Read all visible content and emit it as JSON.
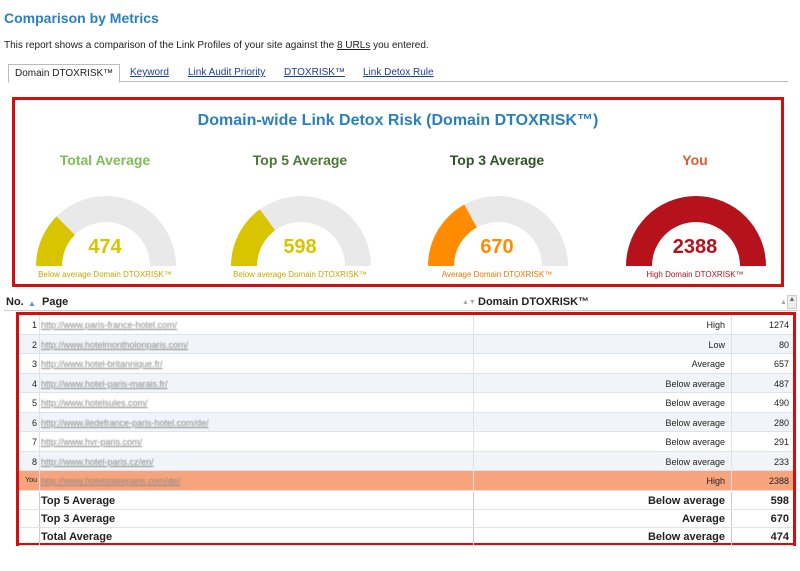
{
  "header": {
    "title": "Comparison by Metrics",
    "intro_before": "This report shows a comparison of the Link Profiles of your site against the ",
    "intro_link": "8 URLs",
    "intro_after": " you entered."
  },
  "tabs": [
    "Domain DTOXRISK™",
    "Keyword",
    "Link Audit Priority",
    "DTOXRISK™",
    "Link Detox Rule"
  ],
  "panel": {
    "title": "Domain-wide Link Detox Risk (Domain DTOXRISK™)",
    "gauges": [
      {
        "label": "Total Average",
        "value": "474",
        "caption": "Below average Domain DTOXRISK™",
        "fraction": 0.25,
        "color": "#d9c400",
        "label_color": "#7cbf55",
        "caption_color": "#c4a800"
      },
      {
        "label": "Top 5 Average",
        "value": "598",
        "caption": "Below average Domain DTOXRISK™",
        "fraction": 0.3,
        "color": "#d9c400",
        "label_color": "#4b7a36",
        "caption_color": "#c4a800"
      },
      {
        "label": "Top 3 Average",
        "value": "670",
        "caption": "Average Domain DTOXRISK™",
        "fraction": 0.34,
        "color": "#ff8c00",
        "label_color": "#2e5426",
        "caption_color": "#e87800"
      },
      {
        "label": "You",
        "value": "2388",
        "caption": "High Domain DTOXRISK™",
        "fraction": 1.0,
        "color": "#b5121b",
        "label_color": "#e05a2a",
        "caption_color": "#b5121b"
      }
    ]
  },
  "table": {
    "headers": {
      "no": "No.",
      "page": "Page",
      "risk": "Domain DTOXRISK™"
    },
    "rows": [
      {
        "no": "1",
        "url": "http://www.paris-france-hotel.com/",
        "risk": "High",
        "value": "1274"
      },
      {
        "no": "2",
        "url": "http://www.hotelmontholonparis.com/",
        "risk": "Low",
        "value": "80"
      },
      {
        "no": "3",
        "url": "http://www.hotel-britannique.fr/",
        "risk": "Average",
        "value": "657"
      },
      {
        "no": "4",
        "url": "http://www.hotel-paris-marais.fr/",
        "risk": "Below average",
        "value": "487"
      },
      {
        "no": "5",
        "url": "http://www.hotelsules.com/",
        "risk": "Below average",
        "value": "490"
      },
      {
        "no": "6",
        "url": "http://www.iledefrance-paris-hotel.com/de/",
        "risk": "Below average",
        "value": "280"
      },
      {
        "no": "7",
        "url": "http://www.hvr-paris.com/",
        "risk": "Below average",
        "value": "291"
      },
      {
        "no": "8",
        "url": "http://www.hotel-paris.cz/en/",
        "risk": "Below average",
        "value": "233"
      },
      {
        "no": "You",
        "url": "http://www.hotelstaseparis.com/de/",
        "risk": "High",
        "value": "2388"
      }
    ],
    "summary": [
      {
        "label": "Top 5 Average",
        "risk": "Below average",
        "value": "598"
      },
      {
        "label": "Top 3 Average",
        "risk": "Average",
        "value": "670"
      },
      {
        "label": "Total Average",
        "risk": "Below average",
        "value": "474"
      }
    ]
  }
}
